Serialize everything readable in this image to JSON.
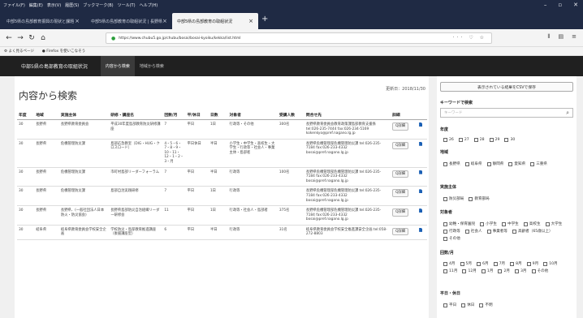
{
  "browser": {
    "menus": [
      "ファイル(F)",
      "編集(E)",
      "表示(V)",
      "履歴(S)",
      "ブックマーク(B)",
      "ツール(T)",
      "ヘルプ(H)"
    ],
    "tabs": [
      {
        "title": "中部5県の島部教育振興の現状と課題"
      },
      {
        "title": "中部5県の島部教育の取組状況 | 長野県"
      },
      {
        "title": "中部5県の島部教育の取組状況"
      }
    ],
    "url": "https://www.chubu5.go.jp/chubu/bosai/bosai-kyoiku/kekka/list.html",
    "bookmarks": [
      "よく見るページ",
      "Firefox を使いこなそう"
    ]
  },
  "site": {
    "title": "中部5県の島部教育の取組状況",
    "nav": [
      "内容から検索",
      "地域から検索"
    ]
  },
  "main": {
    "page_title": "内容から検索",
    "updated": "更新日：2018/11/30",
    "columns": [
      "年度",
      "地域",
      "実施主体",
      "研修・講座名",
      "回数/月",
      "平/休日",
      "日数",
      "対象者",
      "受講人数",
      "問合せ先",
      "詳細",
      ""
    ],
    "rows": [
      {
        "year": "30",
        "region": "長野県",
        "body": "長野県教育委員会",
        "name": "平成30年度島部教育防災研修講座",
        "count": "7",
        "day": "平日",
        "days": "1日",
        "target": "行政等・その他",
        "people": "300名",
        "contact": "長野県教育委員会教育政策課島部教育支援係 tel:026-235-7444 fax:026-234-5169 kokenkyo@pref.nagano.lg.jp",
        "detail": "Q詳細"
      },
      {
        "year": "30",
        "region": "長野県",
        "body": "危機管理防災課",
        "name": "島部応急教室（DIG・HUG・クロスロード）",
        "count": "4・5・6・7・8・9・10・11・12・1・2・3・月",
        "day": "平日休日",
        "days": "半日",
        "target": "小学生・中学生・高校生・大学生・行政等・社会人・事業主体・島部者",
        "people": "",
        "contact": "長野県危機管理部危機管理防災課 tel:026-235-7184 fax:026-233-4332 bosai@pref.nagano.lg.jp",
        "detail": "Q詳細"
      },
      {
        "year": "30",
        "region": "長野県",
        "body": "危機管理防災課",
        "name": "市町村島部リーダーフォーラム",
        "count": "7",
        "day": "平日",
        "days": "半日",
        "target": "行政等",
        "people": "100名",
        "contact": "長野県危機管理部危機管理防災課 tel:026-235-7184 fax:026-233-4332 bosai@pref.nagano.lg.jp",
        "detail": "Q詳細"
      },
      {
        "year": "30",
        "region": "長野県",
        "body": "危機管理防災課",
        "name": "島部自治実践研修",
        "count": "7",
        "day": "平日",
        "days": "1日",
        "target": "行政等",
        "people": "",
        "contact": "長野県危機管理部危機管理防災課 tel:026-235-7184 fax:026-233-4332 bosai@pref.nagano.lg.jp",
        "detail": "Q詳細"
      },
      {
        "year": "30",
        "region": "長野県",
        "body": "長野県、(一般社団法人日本防火・防災協会)",
        "name": "長野県島部防災自治組織リーダー研修会",
        "count": "11",
        "day": "平日",
        "days": "1日",
        "target": "行政等・社会人・島部者",
        "people": "375名",
        "contact": "長野県危機管理部危機管理防災課 tel:026-235-7184 fax:026-233-4332 bosai@pref.nagano.lg.jp",
        "detail": "Q詳細"
      },
      {
        "year": "30",
        "region": "岐阜県",
        "body": "岐阜県教育委員会学校安全企画",
        "name": "学校防災・島部教育推進講座（後援講座型）",
        "count": "6",
        "day": "平日",
        "days": "半日",
        "target": "行政等",
        "people": "31名",
        "contact": "岐阜県教育委員会学校安全推進課安全企画 tel:058-272-8803",
        "detail": "Q詳細"
      }
    ]
  },
  "sidebar": {
    "csv_button": "表示されている結果をCSVで保存",
    "keyword_heading": "キーワードで検索",
    "keyword_placeholder": "キーワード",
    "year_heading": "年度",
    "years": [
      "26",
      "27",
      "28",
      "29",
      "30"
    ],
    "region_heading": "地域",
    "regions": [
      "長野県",
      "岐阜県",
      "静岡県",
      "愛知県",
      "三重県"
    ],
    "body_heading": "実施主体",
    "bodies": [
      "防災部局",
      "教育部局"
    ],
    "target_heading": "対象者",
    "targets": [
      "幼稚・保育園児",
      "小学生",
      "中学生",
      "高校生",
      "大学生",
      "行政等",
      "社会人",
      "事業者等",
      "高齢者（65歳以上）",
      "その他"
    ],
    "month_heading": "回数/月",
    "months": [
      "4月",
      "5月",
      "6月",
      "7月",
      "8月",
      "9月",
      "10月",
      "11月",
      "12月",
      "1月",
      "2月",
      "3月",
      "その他"
    ],
    "day_heading": "平日・休日",
    "days": [
      "平日",
      "休日",
      "不明"
    ]
  }
}
